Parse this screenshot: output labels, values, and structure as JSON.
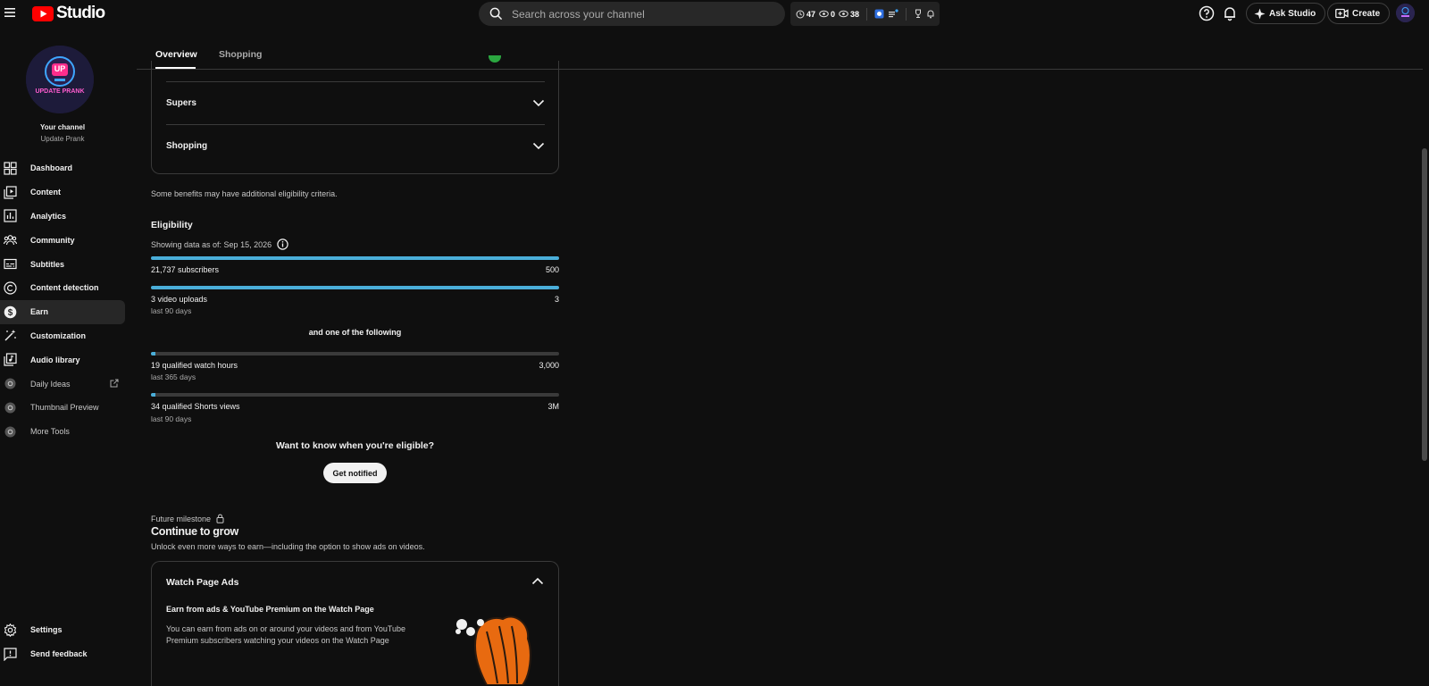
{
  "header": {
    "logo_text": "Studio",
    "search_placeholder": "Search across your channel",
    "stats": {
      "watch": "47",
      "views": "0",
      "views2": "38"
    },
    "ask_studio": "Ask Studio",
    "create": "Create"
  },
  "sidebar": {
    "avatar_top_text": "UP",
    "avatar_bottom_text": "UPDATE PRANK",
    "your_channel": "Your channel",
    "channel_name": "Update Prank",
    "items": [
      {
        "label": "Dashboard",
        "icon": "dashboard-icon"
      },
      {
        "label": "Content",
        "icon": "content-icon"
      },
      {
        "label": "Analytics",
        "icon": "analytics-icon"
      },
      {
        "label": "Community",
        "icon": "community-icon"
      },
      {
        "label": "Subtitles",
        "icon": "subtitles-icon"
      },
      {
        "label": "Content detection",
        "icon": "copyright-icon"
      },
      {
        "label": "Earn",
        "icon": "dollar-icon"
      },
      {
        "label": "Customization",
        "icon": "magic-wand-icon"
      },
      {
        "label": "Audio library",
        "icon": "audio-library-icon"
      },
      {
        "label": "Daily Ideas",
        "icon": "extension-icon"
      },
      {
        "label": "Thumbnail Preview",
        "icon": "extension-icon"
      },
      {
        "label": "More Tools",
        "icon": "extension-icon"
      }
    ],
    "settings": "Settings",
    "feedback": "Send feedback"
  },
  "tabs": {
    "overview": "Overview",
    "shopping": "Shopping"
  },
  "benefits": {
    "supers": "Supers",
    "shopping": "Shopping",
    "note": "Some benefits may have additional eligibility criteria."
  },
  "eligibility": {
    "title": "Eligibility",
    "date": "Showing data as of: Sep 15, 2026",
    "subscribers": {
      "label": "21,737 subscribers",
      "target": "500",
      "progress": 1.0
    },
    "uploads": {
      "label": "3 video uploads",
      "sub": "last 90 days",
      "target": "3",
      "progress": 1.0
    },
    "and_one": "and one of the following",
    "watch_hours": {
      "label": "19 qualified watch hours",
      "sub": "last 365 days",
      "target": "3,000",
      "progress": 0.006
    },
    "shorts": {
      "label": "34 qualified Shorts views",
      "sub": "last 90 days",
      "target": "3M",
      "progress": 1e-05
    },
    "want": "Want to know when you're eligible?",
    "notify": "Get notified"
  },
  "future": {
    "label": "Future milestone",
    "title": "Continue to grow",
    "desc": "Unlock even more ways to earn—including the option to show ads on videos.",
    "card_title": "Watch Page Ads",
    "earn_title": "Earn from ads & YouTube Premium on the Watch Page",
    "earn_desc": "You can earn from ads on or around your videos and from YouTube Premium subscribers watching your videos on the Watch Page"
  },
  "colors": {
    "accent": "#4aaed9",
    "brand_red": "#ff0000",
    "earn_orange": "#ff7a1a"
  }
}
